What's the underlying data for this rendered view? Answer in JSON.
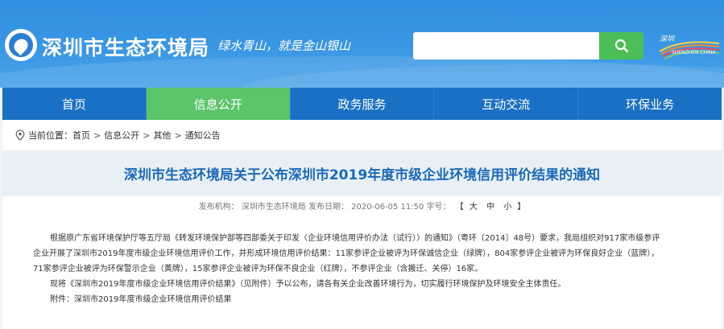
{
  "header": {
    "site_title": "深圳市生态环境局",
    "slogan": "绿水青山，就是金山银山",
    "search_placeholder": "",
    "brand_text": "SHENZHEN CHINA",
    "colors": {
      "header_blue": "#3a97e4",
      "search_green": "#4cbf58",
      "nav_blue": "#1a70c4",
      "nav_active": "#5cc56a",
      "title_blue": "#1a69b8"
    }
  },
  "nav": {
    "items": [
      {
        "label": "首页"
      },
      {
        "label": "信息公开"
      },
      {
        "label": "政务服务"
      },
      {
        "label": "互动交流"
      },
      {
        "label": "环保业务"
      }
    ]
  },
  "breadcrumb": {
    "prefix": "当前位置：",
    "items": [
      "首页",
      "信息公开",
      "其他",
      "通知公告"
    ],
    "separator": ">"
  },
  "article": {
    "title": "深圳市生态环境局关于公布深圳市2019年度市级企业环境信用评价结果的通知",
    "meta": {
      "publisher_label": "发布机构：",
      "publisher": "深圳市生态环境局",
      "date_label": "发布日期：",
      "date": "2020-06-05 11:50",
      "size_label": "字号：",
      "size_open": "【",
      "size_large": "大",
      "size_medium": "中",
      "size_small": "小",
      "size_close": "】"
    },
    "paragraphs": [
      "根据原广东省环境保护厅等五厅局《转发环境保护部等四部委关于印发〈企业环境信用评价办法（试行）〉的通知》（粤环〔2014〕48号）要求，我局组织对917家市级参评",
      "企业开展了深圳市2019年度市级企业环境信用评价工作，并形成环境信用评价结果：11家参评企业被评为环保诚信企业（绿牌），804家参评企业被评为环保良好企业（蓝牌），",
      "71家参评企业被评为环保警示企业（黄牌），15家参评企业被评为环保不良企业（红牌），不参评企业（含搬迁、关停）16家。",
      "现将《深圳市2019年度市级企业环境信用评价结果》（见附件）予以公布，请各有关企业改善环境行为，切实履行环境保护及环境安全主体责任。",
      "附件：深圳市2019年度市级企业环境信用评价结果"
    ]
  }
}
